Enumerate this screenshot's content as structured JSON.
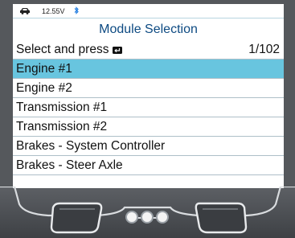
{
  "status": {
    "vehicle_icon": "car-icon",
    "voltage": "12.55V",
    "connection_icon": "bluetooth-icon"
  },
  "screen": {
    "title": "Module Selection",
    "prompt": "Select and press",
    "prompt_icon": "enter-key-icon",
    "page_indicator": "1/102"
  },
  "modules": [
    {
      "label": "Engine #1",
      "selected": true
    },
    {
      "label": "Engine #2",
      "selected": false
    },
    {
      "label": "Transmission #1",
      "selected": false
    },
    {
      "label": "Transmission #2",
      "selected": false
    },
    {
      "label": "Brakes - System Controller",
      "selected": false
    },
    {
      "label": "Brakes - Steer Axle",
      "selected": false
    }
  ],
  "colors": {
    "title": "#0d4a82",
    "selection": "#68c5df",
    "bezel": "#55585c",
    "bluetooth": "#1e7be0"
  }
}
